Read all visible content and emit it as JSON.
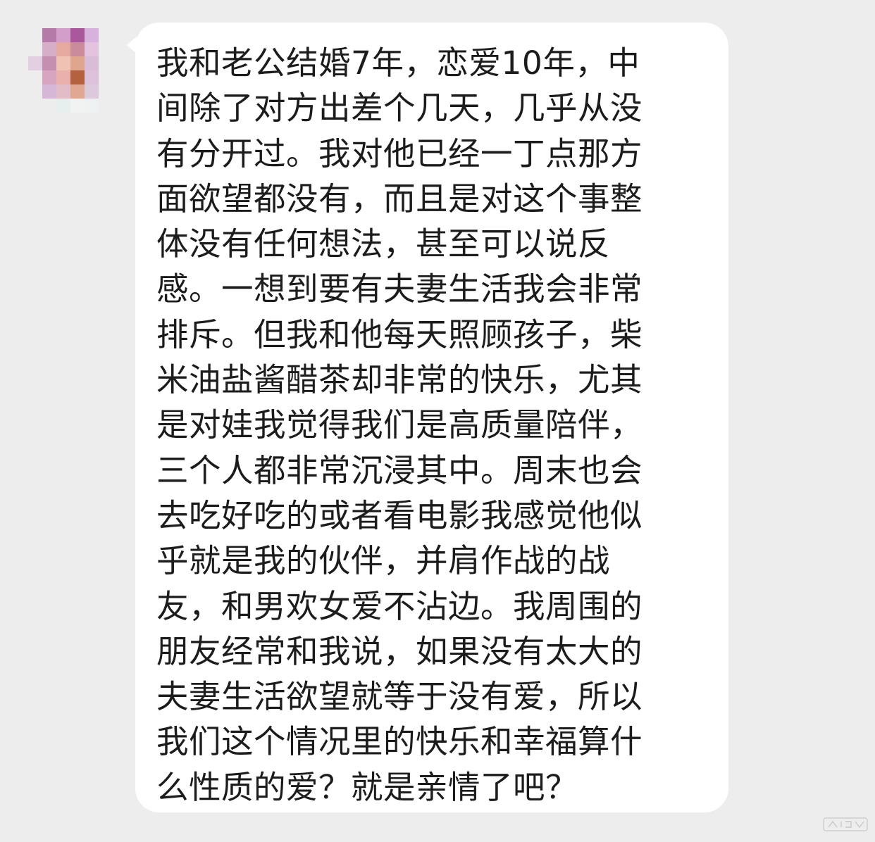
{
  "sender": {
    "avatar_icon": "pixelated-avatar-icon",
    "avatar_colors": [
      "#c79dd0",
      "#d8b5dd",
      "#b57aa8",
      "#e8bfc4",
      "#f0c9b4",
      "#cf8f92",
      "#dba58f",
      "#e6b6a8",
      "#b86a5b"
    ]
  },
  "message": {
    "lines": [
      "我和老公结婚7年，恋爱10年，中",
      "间除了对方出差个几天，几乎从没",
      "有分开过。我对他已经一丁点那方",
      "面欲望都没有，而且是对这个事整",
      "体没有任何想法，甚至可以说反",
      "感。一想到要有夫妻生活我会非常",
      "排斥。但我和他每天照顾孩子，柴",
      "米油盐酱醋茶却非常的快乐，尤其",
      "是对娃我觉得我们是高质量陪伴，",
      "三个人都非常沉浸其中。周末也会",
      "去吃好吃的或者看电影我感觉他似",
      "乎就是我的伙伴，并肩作战的战",
      "友，和男欢女爱不沾边。我周围的",
      "朋友经常和我说，如果没有太大的",
      "夫妻生活欲望就等于没有爱，所以",
      "我们这个情况里的快乐和幸福算什",
      "么性质的爱？就是亲情了吧？"
    ]
  },
  "colors": {
    "background": "#ededed",
    "bubble": "#ffffff",
    "text": "#1c1c1c"
  }
}
